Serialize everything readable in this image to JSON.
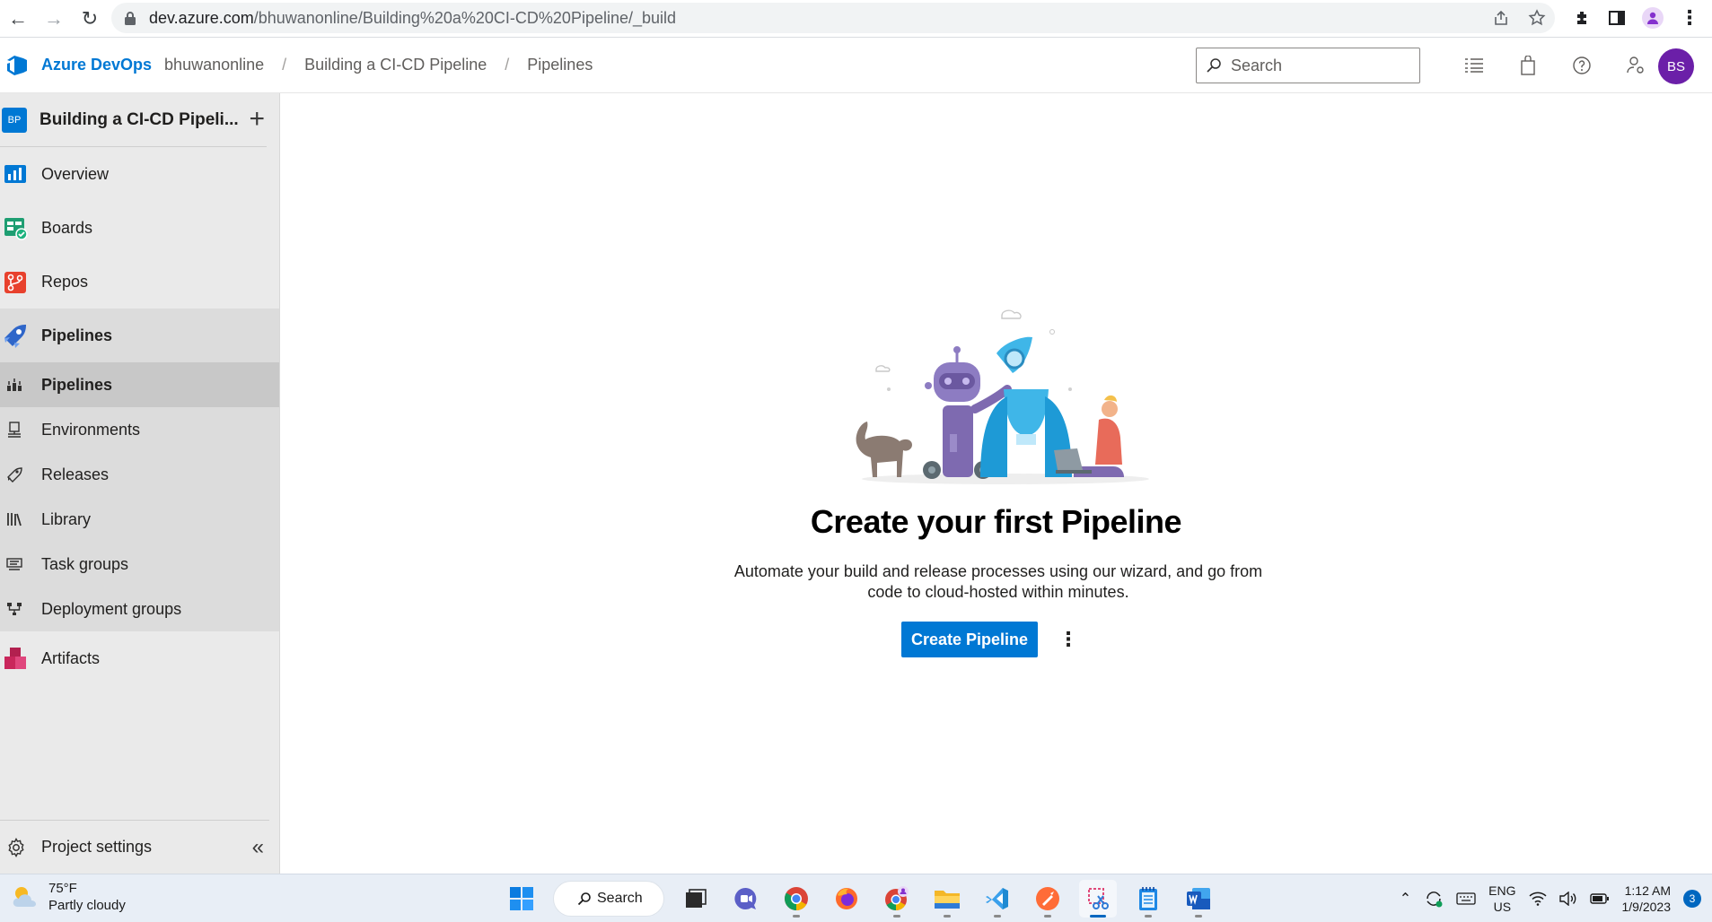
{
  "browser": {
    "url_host": "dev.azure.com",
    "url_path": "/bhuwanonline/Building%20a%20CI-CD%20Pipeline/_build"
  },
  "header": {
    "brand": "Azure DevOps",
    "breadcrumbs": [
      "bhuwanonline",
      "Building a CI-CD Pipeline",
      "Pipelines"
    ],
    "separator": "/",
    "search_placeholder": "Search",
    "avatar_initials": "BS"
  },
  "sidebar": {
    "project_badge": "BP",
    "project_name": "Building a CI-CD Pipeli...",
    "add_label": "+",
    "items": [
      {
        "label": "Overview",
        "icon": "overview-icon"
      },
      {
        "label": "Boards",
        "icon": "boards-icon"
      },
      {
        "label": "Repos",
        "icon": "repos-icon"
      },
      {
        "label": "Pipelines",
        "icon": "pipelines-icon"
      },
      {
        "label": "Artifacts",
        "icon": "artifacts-icon"
      }
    ],
    "pipeline_subitems": [
      {
        "label": "Pipelines",
        "icon": "pipelines-list-icon"
      },
      {
        "label": "Environments",
        "icon": "environments-icon"
      },
      {
        "label": "Releases",
        "icon": "releases-icon"
      },
      {
        "label": "Library",
        "icon": "library-icon"
      },
      {
        "label": "Task groups",
        "icon": "task-groups-icon"
      },
      {
        "label": "Deployment groups",
        "icon": "deployment-groups-icon"
      }
    ],
    "settings_label": "Project settings",
    "collapse_label": "«"
  },
  "main": {
    "title": "Create your first Pipeline",
    "description": "Automate your build and release processes using our wizard, and go from code to cloud-hosted within minutes.",
    "create_button": "Create Pipeline",
    "more_label": "⋮"
  },
  "taskbar": {
    "temperature": "75°F",
    "weather": "Partly cloudy",
    "search_label": "Search",
    "lang_top": "ENG",
    "lang_bottom": "US",
    "time": "1:12 AM",
    "date": "1/9/2023",
    "notification_count": "3"
  },
  "colors": {
    "accent": "#0078d4",
    "avatar": "#6b1fa8",
    "sidebar_bg": "#eaeaea",
    "sidebar_selected": "#c8c8c8"
  }
}
